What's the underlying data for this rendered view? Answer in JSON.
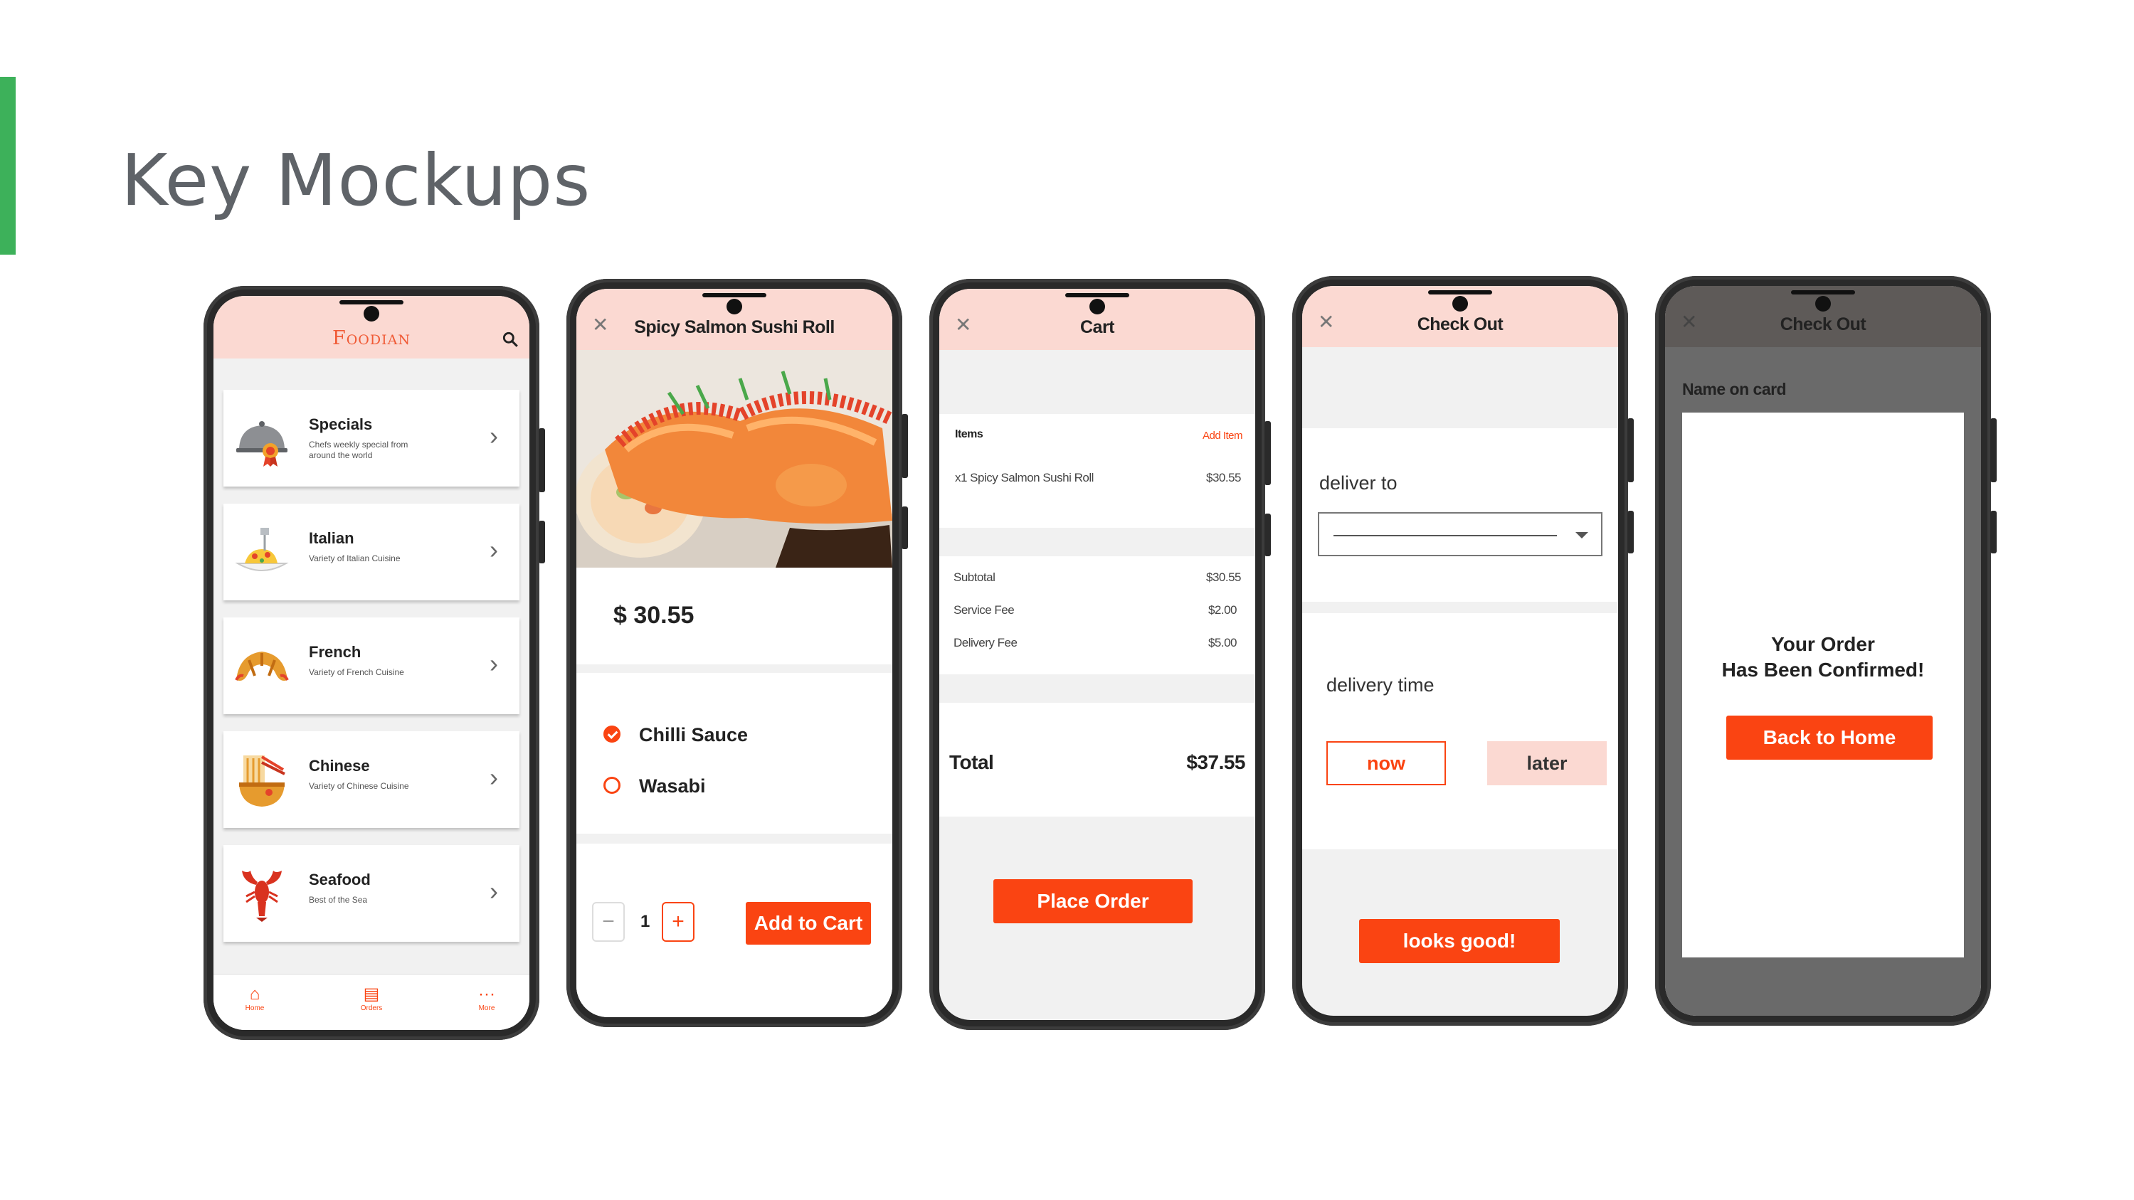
{
  "slide": {
    "title": "Key Mockups"
  },
  "colors": {
    "accent_green": "#3db15a",
    "brand_orange": "#fa4412",
    "appbar_pink": "#fbd9d2"
  },
  "home": {
    "brand": "Foodian",
    "categories": [
      {
        "name": "Specials",
        "desc": "Chefs weekly special from around the world",
        "icon": "cloche-award-icon"
      },
      {
        "name": "Italian",
        "desc": "Variety of Italian Cuisine",
        "icon": "pasta-icon"
      },
      {
        "name": "French",
        "desc": "Variety of French Cuisine",
        "icon": "croissant-icon"
      },
      {
        "name": "Chinese",
        "desc": "Variety of Chinese Cuisine",
        "icon": "noodles-icon"
      },
      {
        "name": "Seafood",
        "desc": "Best of the Sea",
        "icon": "lobster-icon"
      }
    ],
    "tabs": [
      {
        "label": "Home",
        "icon": "home-icon"
      },
      {
        "label": "Orders",
        "icon": "orders-icon"
      },
      {
        "label": "More",
        "icon": "more-icon"
      }
    ]
  },
  "item": {
    "title": "Spicy Salmon Sushi Roll",
    "price": "$ 30.55",
    "options": [
      {
        "label": "Chilli Sauce",
        "selected": true
      },
      {
        "label": "Wasabi",
        "selected": false
      }
    ],
    "quantity": "1",
    "minus": "−",
    "plus": "+",
    "add_to_cart": "Add to Cart"
  },
  "cart": {
    "title": "Cart",
    "items_label": "Items",
    "add_item": "Add Item",
    "line_item": {
      "name": "x1 Spicy Salmon Sushi Roll",
      "price": "$30.55"
    },
    "fees": [
      {
        "label": "Subtotal",
        "value": "$30.55"
      },
      {
        "label": "Service Fee",
        "value": "$2.00"
      },
      {
        "label": "Delivery Fee",
        "value": "$5.00"
      }
    ],
    "total_label": "Total",
    "total_value": "$37.55",
    "place_order": "Place Order"
  },
  "checkout": {
    "title": "Check Out",
    "deliver_to": "deliver to",
    "delivery_time": "delivery time",
    "now": "now",
    "later": "later",
    "confirm": "looks good!"
  },
  "confirmed": {
    "title": "Check Out",
    "name_on_card": "Name on card",
    "message_line1": "Your Order",
    "message_line2": "Has Been Confirmed!",
    "back_home": "Back to Home"
  }
}
